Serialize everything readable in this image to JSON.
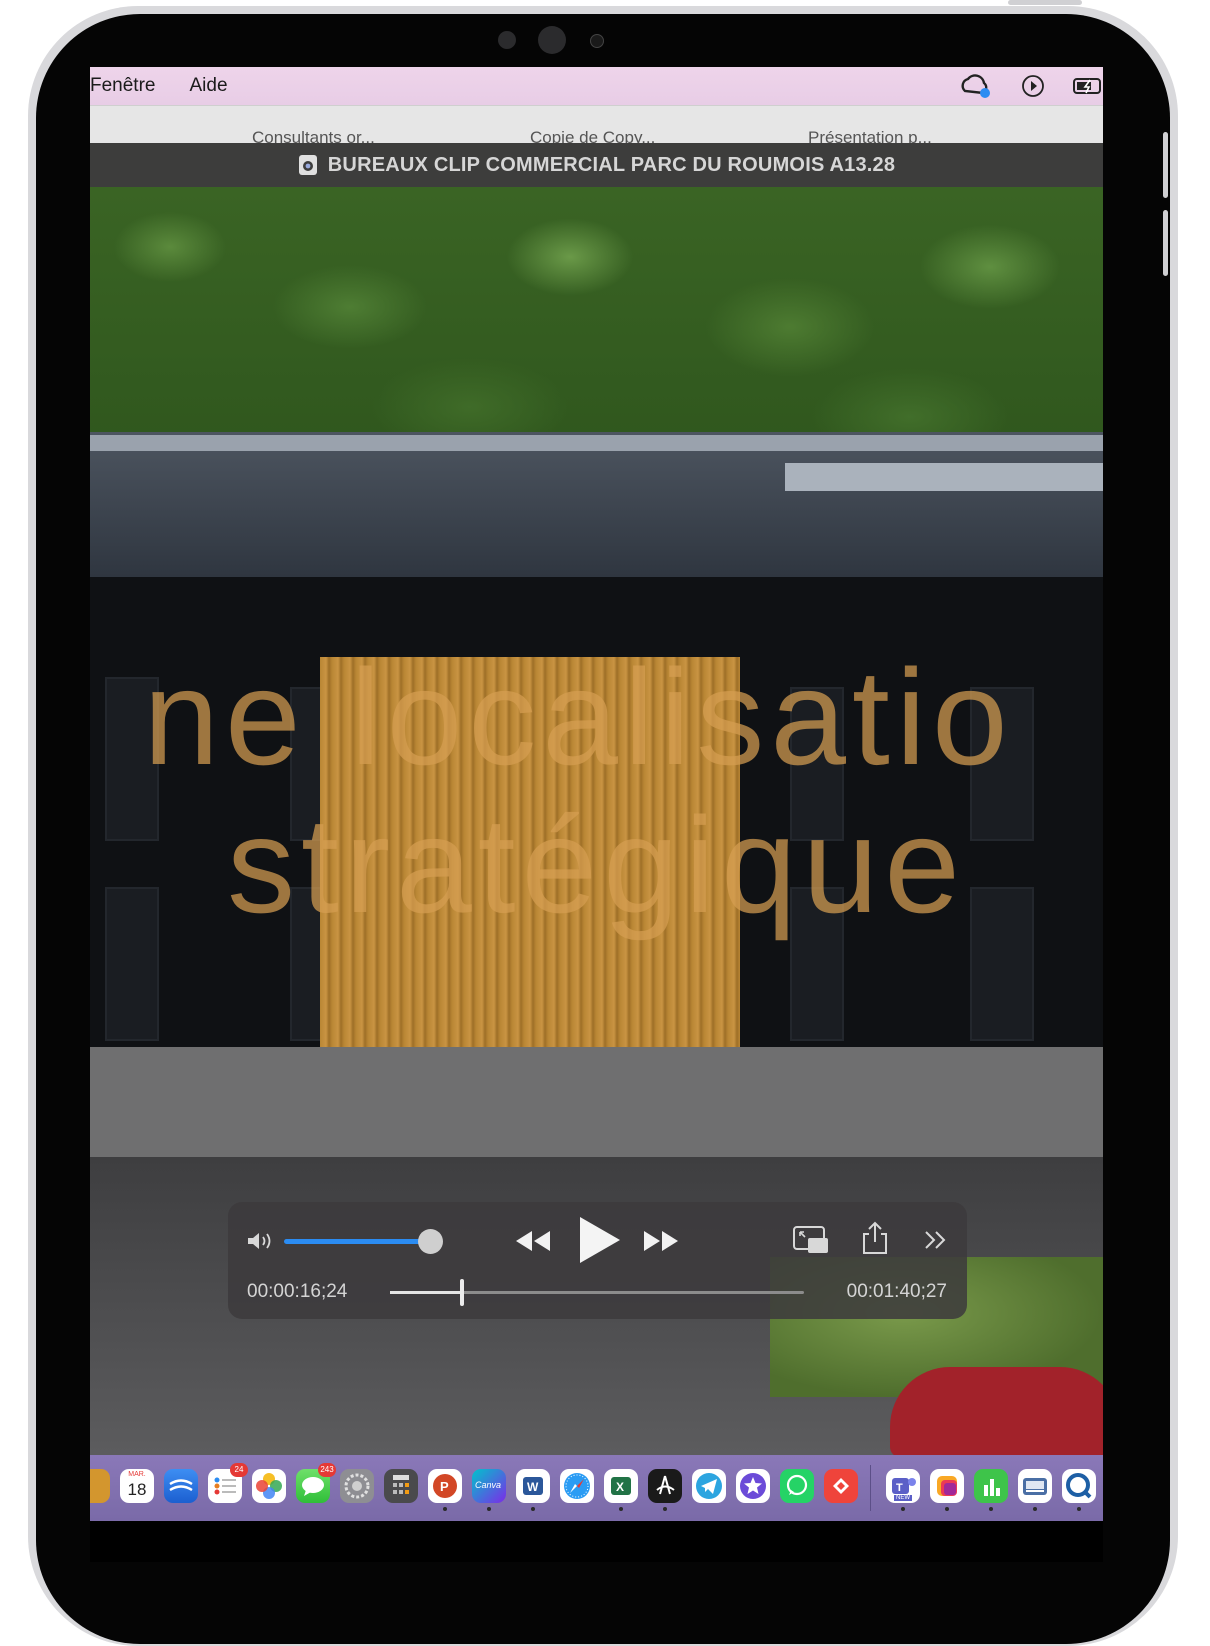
{
  "menubar": {
    "items": [
      "Fenêtre",
      "Aide"
    ]
  },
  "tabs": [
    "Consultants or...",
    "Copie de Copy...",
    "Présentation p..."
  ],
  "window": {
    "title": "BUREAUX CLIP COMMERCIAL PARC DU ROUMOIS A13.28"
  },
  "video": {
    "overlay_line1": "ne localisatio",
    "overlay_line2": "stratégique"
  },
  "player": {
    "current_time": "00:00:16;24",
    "duration": "00:01:40;27",
    "volume_fraction": 0.9,
    "progress_fraction": 0.17
  },
  "dock": {
    "calendar_month": "MAR.",
    "calendar_day": "18",
    "badge_reminders": "24",
    "badge_messages": "243",
    "teams_label": "NEW",
    "canva_label": "Canva"
  },
  "colors": {
    "menubar": "#eed4ea",
    "accent": "#2b8cf2",
    "overlay_text": "#d69e52",
    "dock": "#8a78b8"
  }
}
